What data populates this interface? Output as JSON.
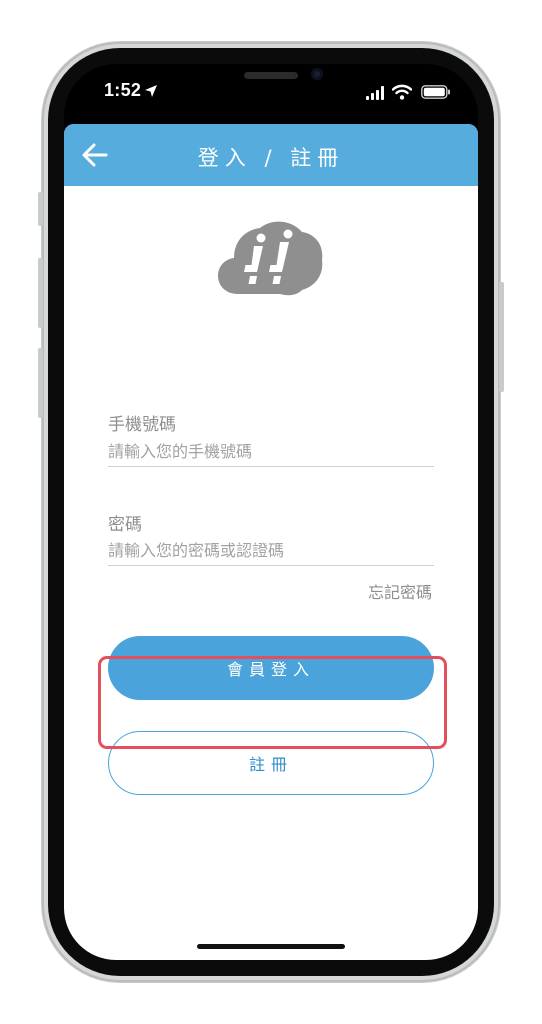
{
  "status_bar": {
    "time": "1:52",
    "icons": [
      "location-arrow-icon",
      "cellular-signal-icon",
      "wifi-icon",
      "battery-icon"
    ]
  },
  "nav": {
    "title": "登入 / 註冊",
    "back_icon": "back-arrow-icon"
  },
  "logo": {
    "icon": "cloud-logo-icon"
  },
  "phone_field": {
    "label": "手機號碼",
    "placeholder": "請輸入您的手機號碼",
    "value": ""
  },
  "password_field": {
    "label": "密碼",
    "placeholder": "請輸入您的密碼或認證碼",
    "value": ""
  },
  "forgot_password": "忘記密碼",
  "login_button": "會員登入",
  "register_button": "註冊",
  "colors": {
    "nav_bar": "#55acdd",
    "primary_button": "#4aa3da",
    "highlight": "#e34f5c",
    "logo": "#8f8f8f"
  }
}
